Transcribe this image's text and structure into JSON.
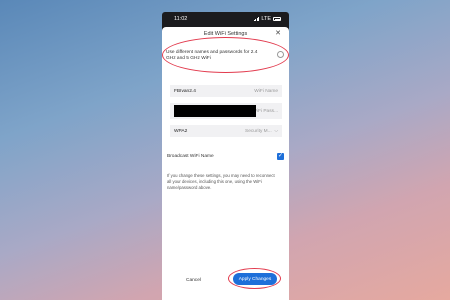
{
  "status_bar": {
    "time": "11:02",
    "network": "LTE"
  },
  "dialog": {
    "title": "Edit WiFi Settings",
    "split_label": "Use different names and passwords for 2.4 GHz and 5 GHz WiFi",
    "wifi_name_value": "FBIvan2.4",
    "wifi_name_placeholder": "WiFi Name",
    "password_placeholder": "WiFi Pass...",
    "security_value": "WPA2",
    "security_placeholder": "Security M...",
    "broadcast_label": "Broadcast WiFi Name",
    "info_text": "If you change these settings, you may need to reconnect all your devices, including this one, using the WiFi name/password above.",
    "cancel_label": "Cancel",
    "apply_label": "Apply Changes"
  },
  "colors": {
    "accent": "#1e6fd9",
    "highlight": "#e23b4e"
  }
}
